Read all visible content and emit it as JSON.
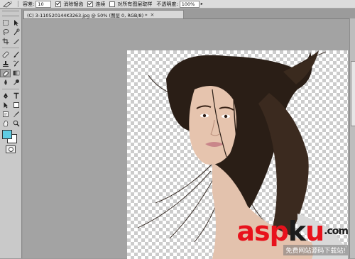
{
  "options_bar": {
    "tolerance_label": "容差:",
    "tolerance_value": "10",
    "antialias_label": "消除锯齿",
    "antialias_checked": true,
    "contiguous_label": "连续",
    "contiguous_checked": true,
    "all_layers_label": "对所有图层取样",
    "all_layers_checked": false,
    "opacity_label": "不透明度:",
    "opacity_value": "100%"
  },
  "document": {
    "tab_title": "(C) 3-110520144K3263.jpg @ 50% (图层 0, RGB/8) *",
    "close_glyph": "×"
  },
  "toolbox": {
    "foreground_color": "#5fcde4",
    "background_color": "#ffffff",
    "tools": [
      "move-icon",
      "marquee-icon",
      "lasso-icon",
      "quick-select-icon",
      "crop-icon",
      "slice-icon",
      "healing-icon",
      "brush-icon",
      "clone-stamp-icon",
      "history-brush-icon",
      "eraser-icon",
      "gradient-icon",
      "blur-icon",
      "dodge-icon",
      "pen-icon",
      "type-icon",
      "path-select-icon",
      "shape-icon",
      "notes-icon",
      "eyedropper-icon",
      "hand-icon",
      "zoom-icon"
    ]
  },
  "watermark": {
    "brand_a": "asp",
    "brand_b": "k",
    "brand_c": "u",
    "brand_d": ".com",
    "subtitle": "免费网站源码下载站!"
  }
}
